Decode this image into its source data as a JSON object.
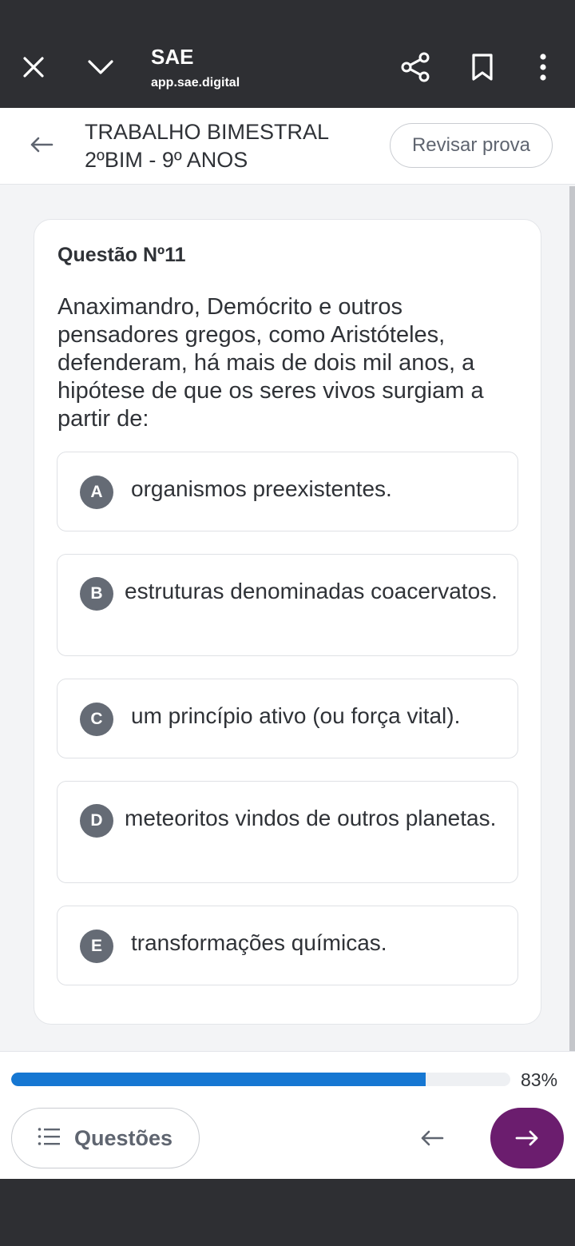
{
  "browser": {
    "title": "SAE",
    "url": "app.sae.digital",
    "icons": [
      "close-icon",
      "chevron-down-icon",
      "share-icon",
      "bookmark-icon",
      "more-vert-icon"
    ]
  },
  "header": {
    "title_line1": "TRABALHO BIMESTRAL",
    "title_line2": "2ºBIM - 9º ANOS",
    "review_button": "Revisar prova"
  },
  "question": {
    "number_label": "Questão Nº11",
    "text": "Anaximandro, Demócrito e outros pensadores gregos, como Aristóteles, defenderam, há mais de dois mil anos, a hipótese de que os seres vivos surgiam a partir de:",
    "options": [
      {
        "letter": "A",
        "text": "organismos preexistentes."
      },
      {
        "letter": "B",
        "text": "estruturas denominadas coacervatos."
      },
      {
        "letter": "C",
        "text": "um princípio ativo (ou força vital)."
      },
      {
        "letter": "D",
        "text": "meteoritos vindos de outros planetas."
      },
      {
        "letter": "E",
        "text": "transformações químicas."
      }
    ]
  },
  "footer": {
    "progress_percent": 83,
    "progress_label": "83%",
    "questions_button": "Questões"
  },
  "colors": {
    "accent_progress": "#1677d2",
    "next_button": "#6b1d6e",
    "option_badge": "#656b75",
    "browser_bar": "#2e2f33"
  }
}
